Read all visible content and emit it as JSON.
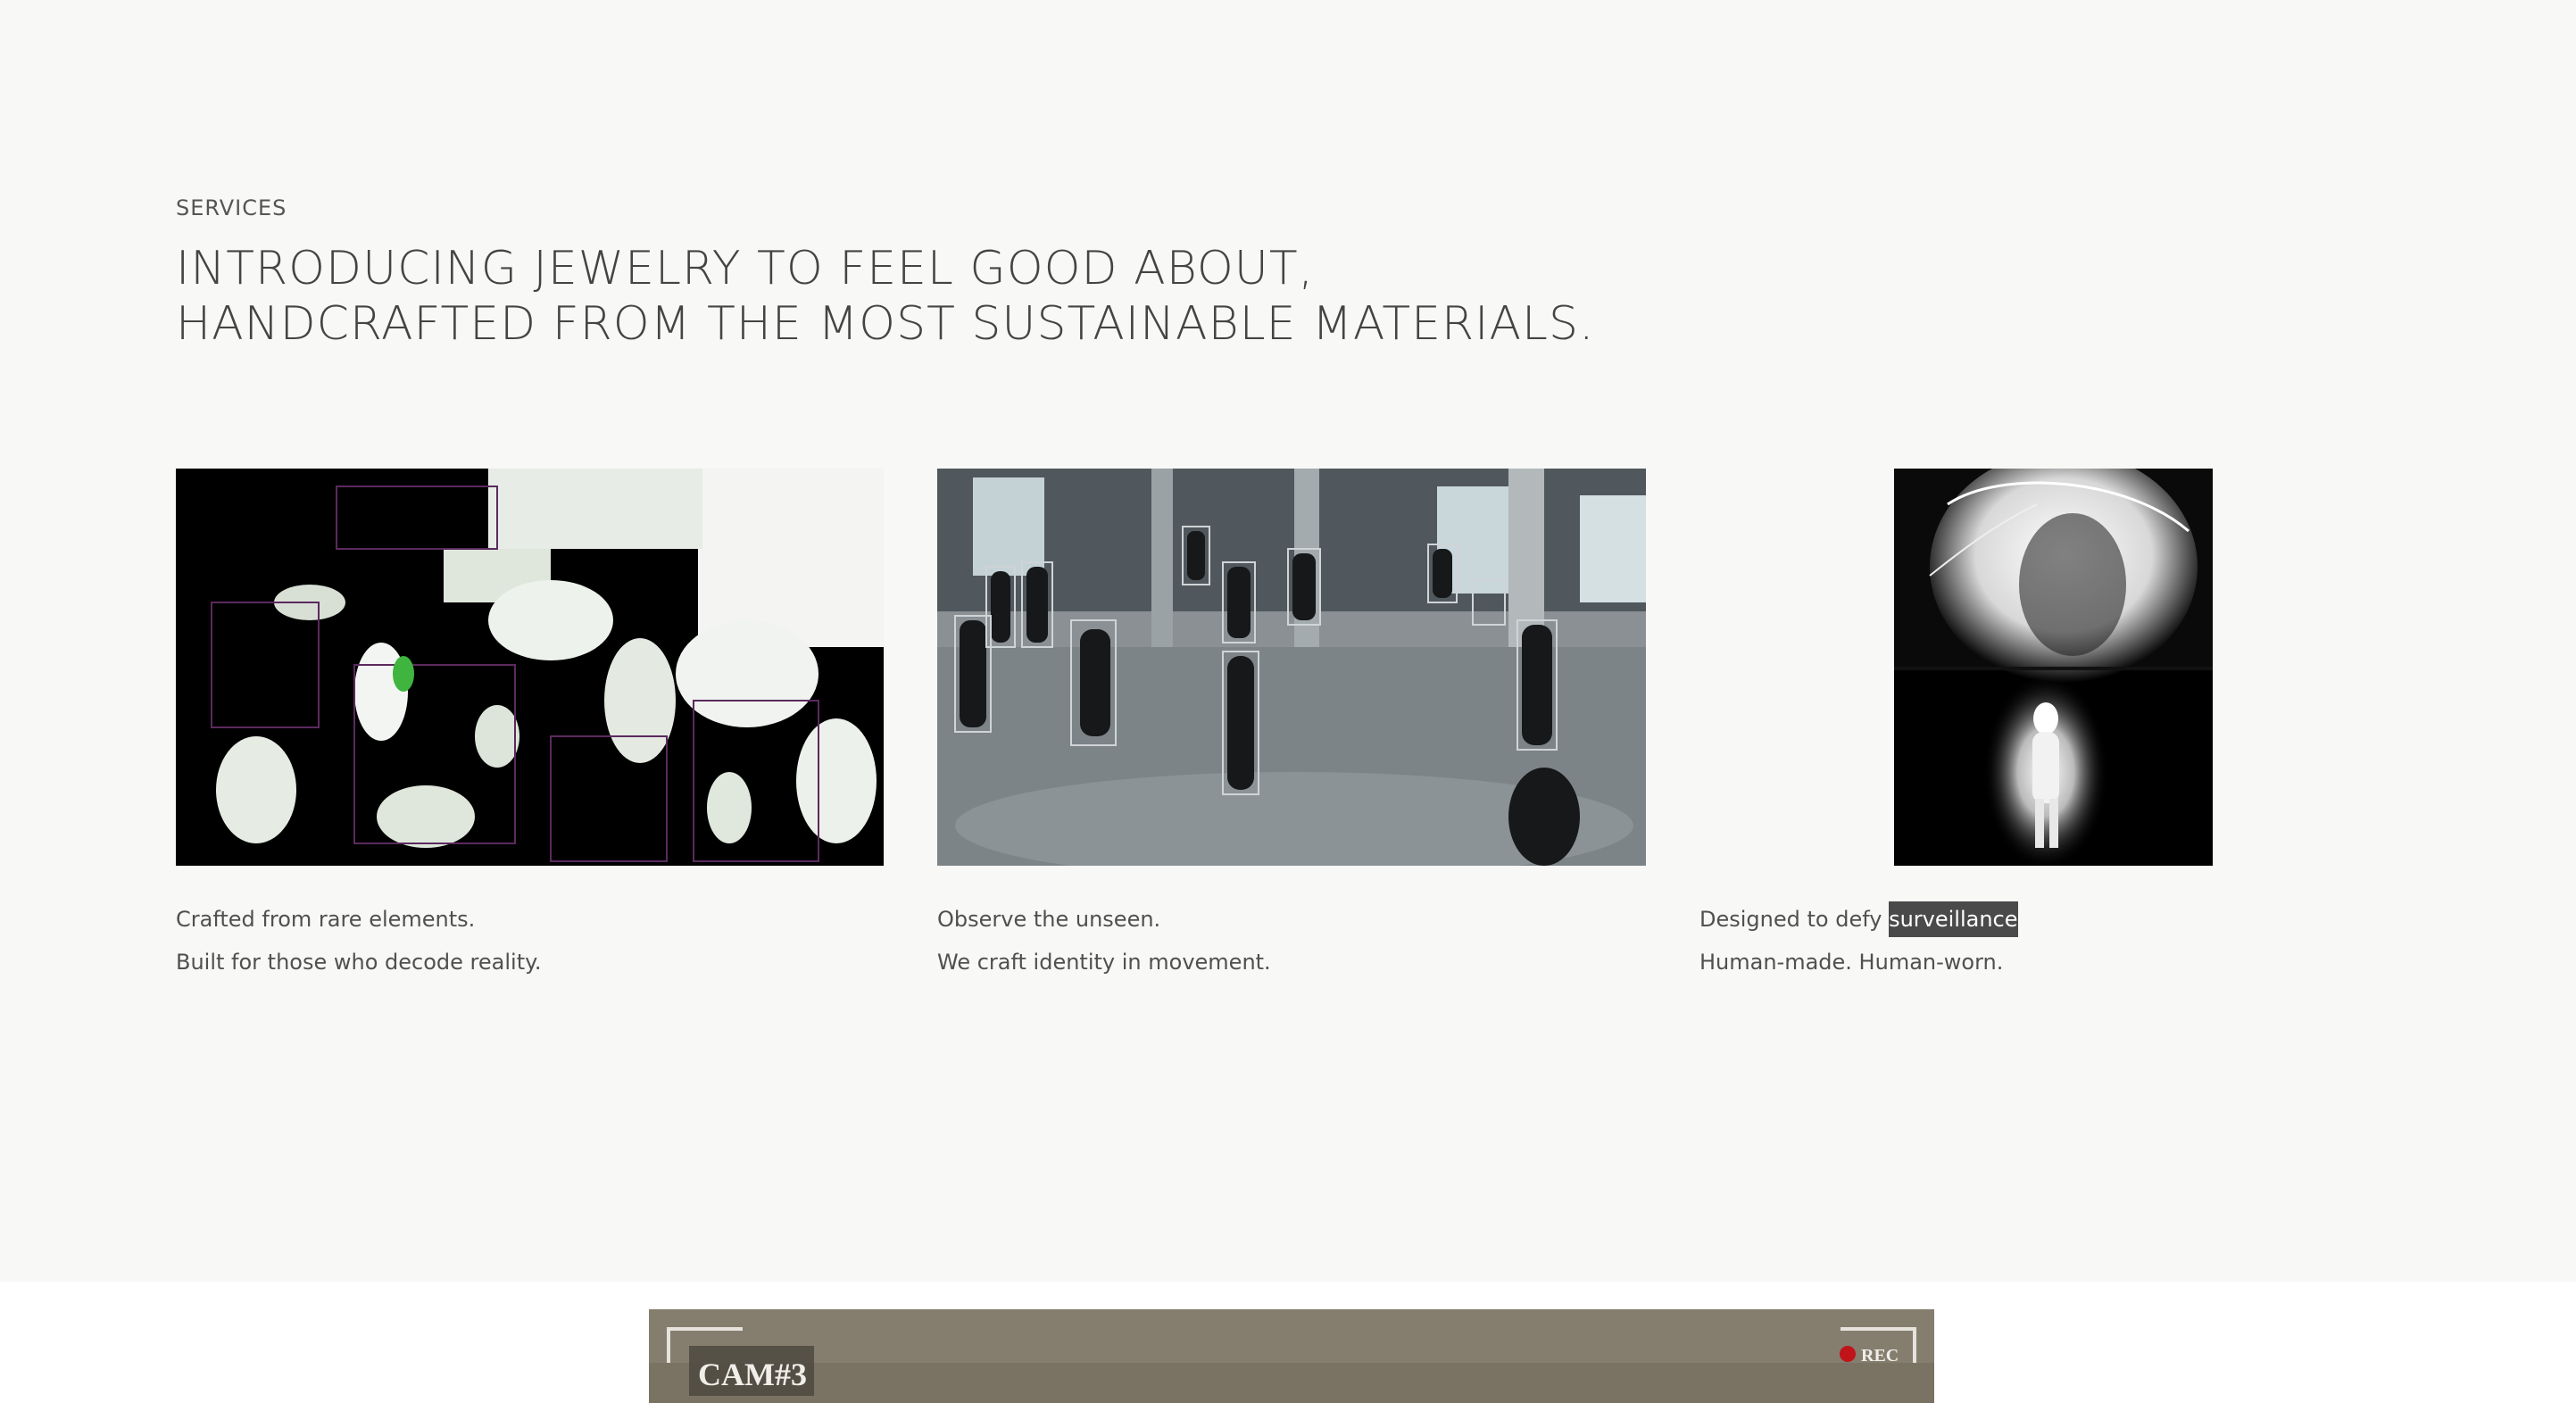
{
  "services": {
    "eyebrow": "SERVICES",
    "headline_line1": "INTRODUCING JEWELRY TO FEEL GOOD ABOUT,",
    "headline_line2": "HANDCRAFTED FROM THE MOST SUSTAINABLE MATERIALS."
  },
  "cards": [
    {
      "image": "glitch-crowd-image",
      "line1": "Crafted from rare elements.",
      "line2": "Built for those who decode reality."
    },
    {
      "image": "surveillance-detection-image",
      "line1": "Observe the unseen.",
      "line2": "We craft identity in movement."
    },
    {
      "image": "glowing-figures-image",
      "line1_prefix": "Designed to defy ",
      "line1_highlight": "surveillance",
      "line2": "Human-made. Human-worn."
    }
  ],
  "video": {
    "camera_label": "CAM#3",
    "rec_label": "REC",
    "rec_color": "#c0141a"
  },
  "colors": {
    "background": "#f8f8f6",
    "text": "#4a4a4a",
    "highlight_bg": "#4a4a4a"
  }
}
